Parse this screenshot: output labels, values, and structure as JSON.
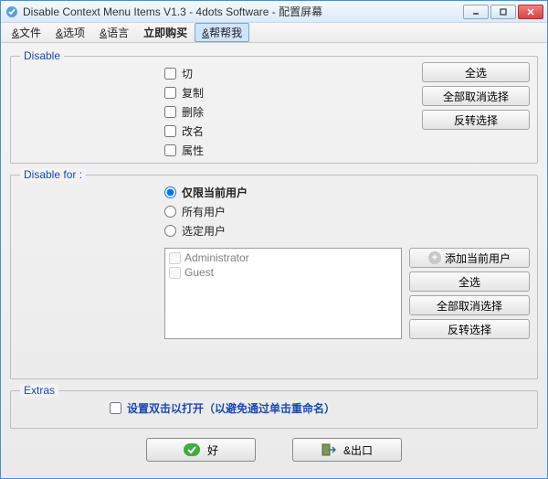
{
  "window": {
    "title": "Disable Context Menu Items V1.3 - 4dots Software - 配置屏幕"
  },
  "menu": {
    "file": "文件",
    "options": "选项",
    "language": "语言",
    "buy_now": "立即购买",
    "help": "帮帮我"
  },
  "group_disable": {
    "legend": "Disable",
    "items": [
      "切",
      "复制",
      "删除",
      "改名",
      "属性"
    ],
    "btn_select_all": "全选",
    "btn_deselect_all": "全部取消选择",
    "btn_invert": "反转选择"
  },
  "group_disable_for": {
    "legend": "Disable for :",
    "radios": [
      "仅限当前用户",
      "所有用户",
      "选定用户"
    ],
    "selected_index": 0,
    "users": [
      "Administrator",
      "Guest"
    ],
    "btn_add_current": "添加当前用户",
    "btn_select_all": "全选",
    "btn_deselect_all": "全部取消选择",
    "btn_invert": "反转选择"
  },
  "group_extras": {
    "legend": "Extras",
    "doubleclick_label": "设置双击以打开（以避免通过单击重命名）"
  },
  "bottom": {
    "ok": "好",
    "exit": "出口"
  }
}
